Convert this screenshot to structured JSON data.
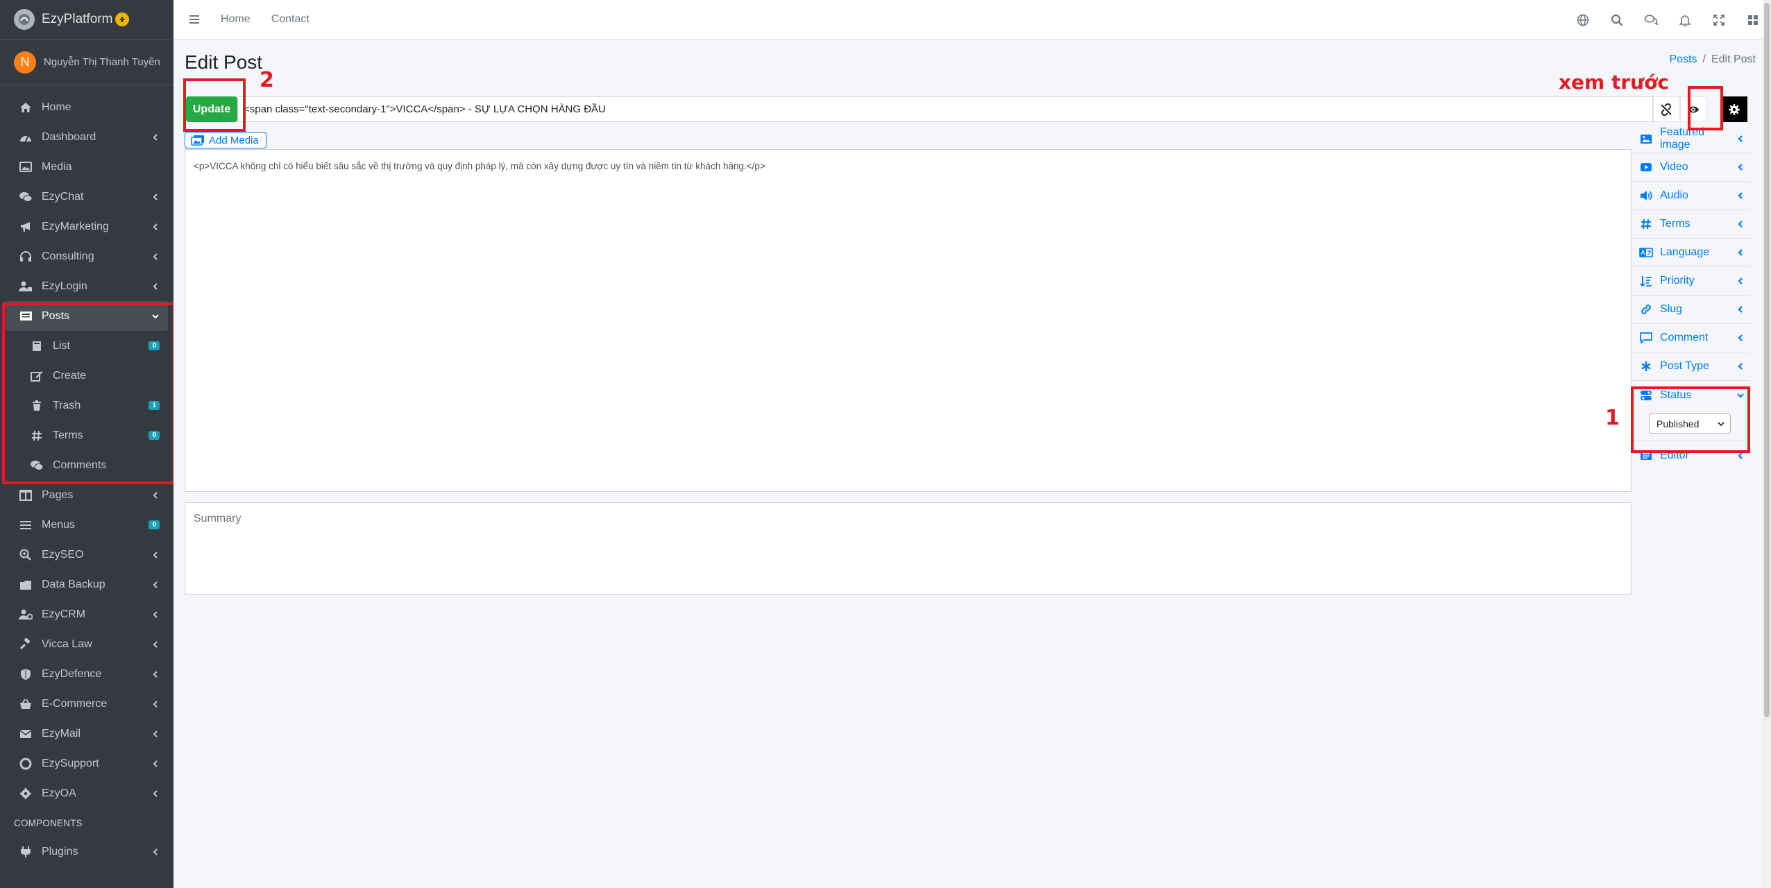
{
  "brand": {
    "name": "EzyPlatform"
  },
  "user": {
    "initial": "N",
    "name": "Nguyễn Thị Thanh Tuyền"
  },
  "sidebar": {
    "items": [
      {
        "label": "Home",
        "icon": "home-icon"
      },
      {
        "label": "Dashboard",
        "icon": "dashboard-icon"
      },
      {
        "label": "Media",
        "icon": "image-icon"
      },
      {
        "label": "EzyChat",
        "icon": "chat-icon"
      },
      {
        "label": "EzyMarketing",
        "icon": "megaphone-icon"
      },
      {
        "label": "Consulting",
        "icon": "headset-icon"
      },
      {
        "label": "EzyLogin",
        "icon": "user-lock-icon"
      },
      {
        "label": "Posts",
        "icon": "newspaper-icon"
      },
      {
        "label": "List",
        "icon": "book-icon",
        "badge": "0"
      },
      {
        "label": "Create",
        "icon": "edit-icon"
      },
      {
        "label": "Trash",
        "icon": "trash-icon",
        "badge": "1"
      },
      {
        "label": "Terms",
        "icon": "hashtag-icon",
        "badge": "0"
      },
      {
        "label": "Comments",
        "icon": "comments-icon"
      },
      {
        "label": "Pages",
        "icon": "columns-icon"
      },
      {
        "label": "Menus",
        "icon": "bars-icon",
        "badge": "0"
      },
      {
        "label": "EzySEO",
        "icon": "search-plus-icon"
      },
      {
        "label": "Data Backup",
        "icon": "database-icon"
      },
      {
        "label": "EzyCRM",
        "icon": "users-cog-icon"
      },
      {
        "label": "Vicca Law",
        "icon": "gavel-icon"
      },
      {
        "label": "EzyDefence",
        "icon": "shield-icon"
      },
      {
        "label": "E-Commerce",
        "icon": "basket-icon"
      },
      {
        "label": "EzyMail",
        "icon": "envelope-icon"
      },
      {
        "label": "EzySupport",
        "icon": "lifebuoy-icon"
      },
      {
        "label": "EzyOA",
        "icon": "cog-icon"
      }
    ],
    "components_header": "COMPONENTS",
    "plugins_label": "Plugins"
  },
  "topbar": {
    "home": "Home",
    "contact": "Contact"
  },
  "page": {
    "title": "Edit Post",
    "breadcrumb_link": "Posts",
    "breadcrumb_sep": "/",
    "breadcrumb_current": "Edit Post",
    "update_label": "Update",
    "post_title": "<span class=\"text-secondary-1\">VICCA</span> - SỰ LỰA CHỌN HÀNG ĐẦU",
    "add_media": "Add Media",
    "content": "<p>VICCA không chỉ có hiểu biết sâu sắc về thị trường và quy định pháp lý, mà còn xây dựng được uy tín và niềm tin từ khách hàng.</p>",
    "summary_placeholder": "Summary"
  },
  "panel": {
    "items": [
      {
        "label": "Featured image",
        "icon": "image-icon"
      },
      {
        "label": "Video",
        "icon": "youtube-icon"
      },
      {
        "label": "Audio",
        "icon": "volume-icon"
      },
      {
        "label": "Terms",
        "icon": "hashtag-icon"
      },
      {
        "label": "Language",
        "icon": "language-icon"
      },
      {
        "label": "Priority",
        "icon": "sort-icon"
      },
      {
        "label": "Slug",
        "icon": "link-icon"
      },
      {
        "label": "Comment",
        "icon": "comment-icon"
      },
      {
        "label": "Post Type",
        "icon": "asterisk-icon"
      }
    ],
    "status_label": "Status",
    "status_value": "Published",
    "editor_label": "Editor"
  },
  "annotations": {
    "one": "1",
    "two": "2",
    "preview": "xem trước"
  },
  "colors": {
    "accent": "#007bff",
    "success": "#28a745",
    "sidebar": "#343a40",
    "annotation": "#e01b24",
    "badge": "#17a2b8"
  }
}
